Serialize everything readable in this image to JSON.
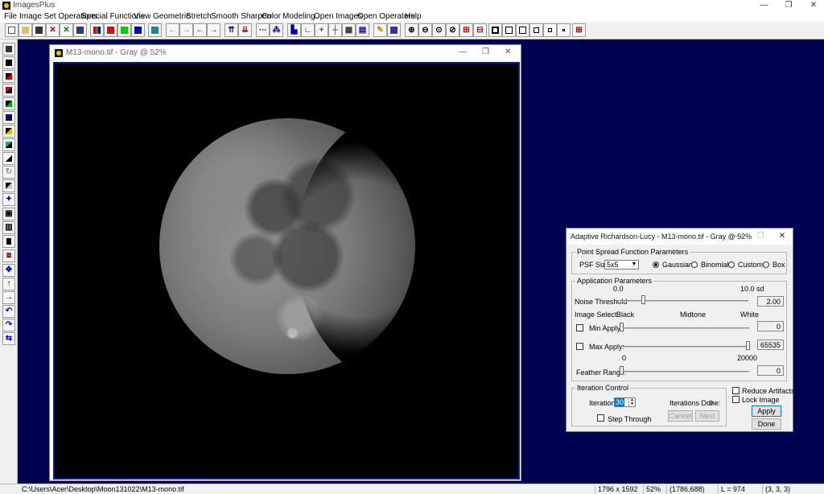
{
  "app": {
    "title": "ImagesPlus"
  },
  "menu": [
    "File",
    "Image Set Operations",
    "Special Functions",
    "View",
    "Geometric",
    "Stretch",
    "Smooth Sharpen",
    "Color",
    "Modeling",
    "Open Images",
    "Open Operators",
    "Help"
  ],
  "window_controls": {
    "minimize": "—",
    "maximize": "❐",
    "close": "✕"
  },
  "image_window": {
    "title": "M13-mono.tif - Gray @ 52%"
  },
  "dialog": {
    "title": "Adaptive Richardson-Lucy - M13-mono.tif - Gray @ 52%",
    "psf": {
      "group_title": "Point Spread Function Parameters",
      "size_label": "PSF Size:",
      "size_value": "5x5",
      "options": [
        "Gaussian",
        "Binomial",
        "Custom",
        "Box"
      ],
      "selected": "Gaussian"
    },
    "application": {
      "group_title": "Application Parameters",
      "noise_min": "0.0",
      "noise_max": "10.0 sd",
      "noise_label": "Noise Threshold",
      "noise_value": "2.00",
      "noise_level": 0.2,
      "image_select": "Image Select",
      "black": "Black",
      "midtone": "Midtone",
      "white": "White",
      "min_apply_label": "Min Apply:",
      "min_apply_value": "0",
      "max_apply_label": "Max Apply:",
      "max_apply_value": "65535",
      "feather_min": "0",
      "feather_max": "20000",
      "feather_label": "Feather Range:",
      "feather_value": "0"
    },
    "iteration": {
      "group_title": "Iteration Control",
      "iterations_label": "Iterations:",
      "iterations_value": "30",
      "done_label": "Iterations Done:",
      "done_value": "0",
      "step_through": "Step Through",
      "cancel": "Cancel",
      "next": "Next"
    },
    "reduce_artifacts": "Reduce Artifacts",
    "lock_image": "Lock Image",
    "apply": "Apply",
    "done": "Done"
  },
  "status": {
    "path": "C:\\Users\\Acer\\Desktop\\Moon131022\\M13-mono.tif",
    "dimensions": "1796 x 1592",
    "zoom": "52%",
    "coords": "(1786,688)",
    "level": "L = 974",
    "rgb": "(3, 3, 3)"
  },
  "colors": {
    "workspace": "#000050",
    "canvas_border": "#0a1a9a"
  },
  "toolbar_icons": [
    "new-icon",
    "open-icon",
    "save-icon",
    "close-icon",
    "close-all-icon",
    "duplicate-icon",
    "rgb-split-icon",
    "red-icon",
    "green-icon",
    "blue-icon",
    "combine-icon",
    "arrow-left-icon",
    "arrow-right-icon",
    "arrow-left-red-icon",
    "arrow-right-red-icon",
    "align-top-icon",
    "align-bottom-icon",
    "dots-icon",
    "network-icon",
    "histogram-icon",
    "curve-icon",
    "plus-icon",
    "crosshair-icon",
    "grid-icon",
    "grid2-icon",
    "pencil-icon",
    "mask-icon",
    "zoom-in-icon",
    "zoom-out-icon",
    "zoom-fit-icon",
    "zoom-actual-icon",
    "zoom-plus-icon",
    "zoom-minus-icon",
    "frame-icon",
    "frame2-icon",
    "frame3-icon",
    "frame4-icon",
    "frame5-icon",
    "frame6-icon",
    "tile-icon"
  ]
}
